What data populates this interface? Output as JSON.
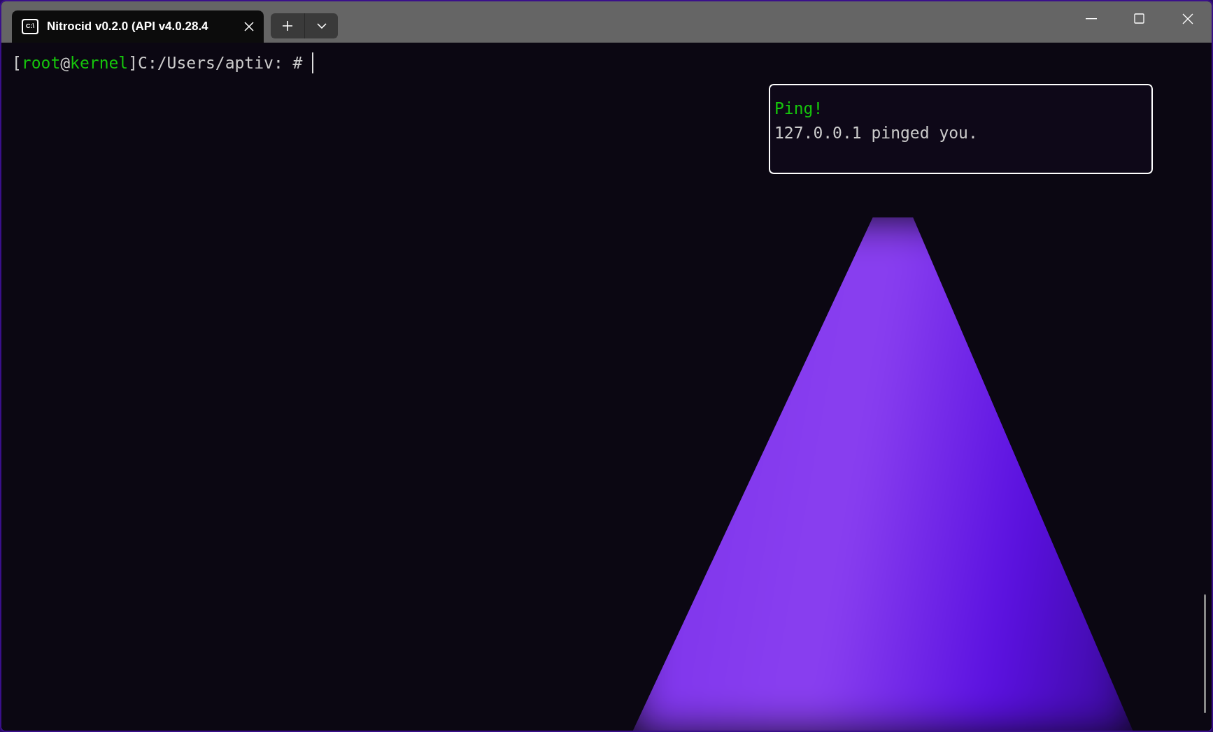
{
  "tab": {
    "icon_text": "C:\\",
    "title": "Nitrocid v0.2.0 (API v4.0.28.4",
    "selected": true
  },
  "prompt": [
    {
      "text": "[",
      "color": "#cccccc"
    },
    {
      "text": "root",
      "color": "#16c60c"
    },
    {
      "text": "@",
      "color": "#cccccc"
    },
    {
      "text": "kernel",
      "color": "#16c60c"
    },
    {
      "text": "]C:/Users/aptiv: #",
      "color": "#cccccc"
    }
  ],
  "notification": {
    "title": "Ping!",
    "message": "127.0.0.1 pinged you."
  }
}
